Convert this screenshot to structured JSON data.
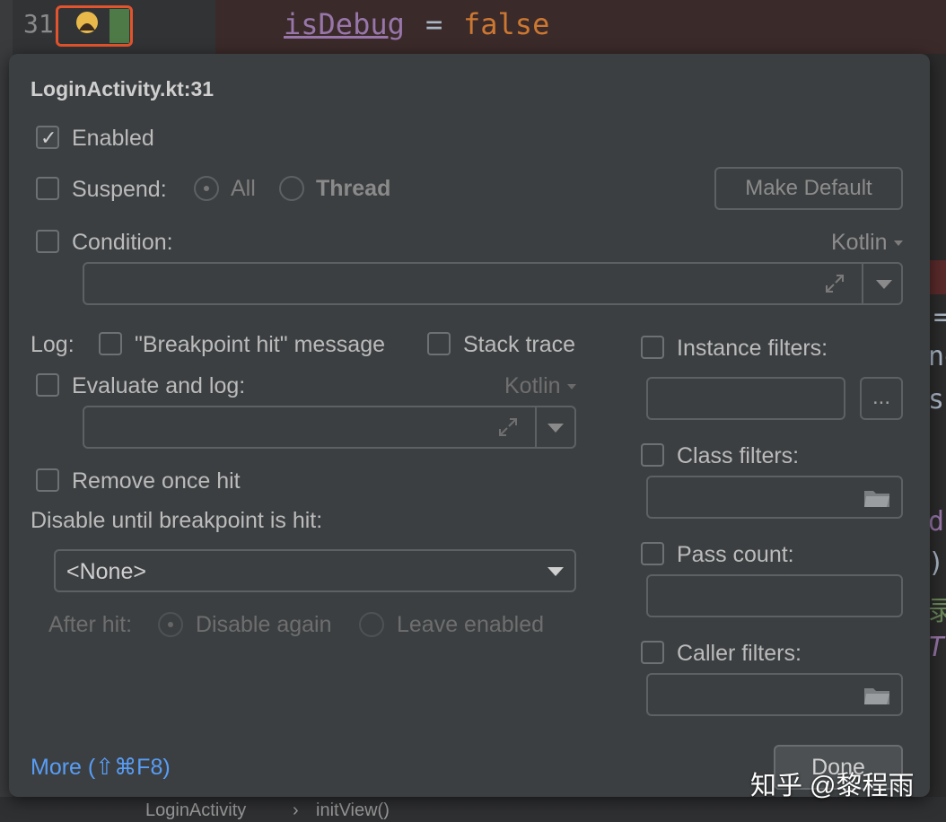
{
  "editor": {
    "line_number": "31",
    "code_variable": "isDebug",
    "code_operator": "=",
    "code_value": "false",
    "right_fragments": [
      "=",
      "ne",
      "s",
      "d",
      ")",
      "录",
      "T"
    ],
    "breadcrumb": [
      "LoginActivity",
      "›",
      "initView()"
    ]
  },
  "dialog": {
    "title": "LoginActivity.kt:31",
    "enabled": {
      "label": "Enabled",
      "checked": true
    },
    "suspend": {
      "label": "Suspend:",
      "checked": false,
      "options": [
        "All",
        "Thread"
      ],
      "selected": "All"
    },
    "make_default_label": "Make Default",
    "condition": {
      "label": "Condition:",
      "checked": false,
      "language": "Kotlin",
      "value": ""
    },
    "log": {
      "label": "Log:",
      "breakpoint_hit_label": "\"Breakpoint hit\" message",
      "stack_trace_label": "Stack trace"
    },
    "evaluate": {
      "label": "Evaluate and log:",
      "checked": false,
      "language": "Kotlin",
      "value": ""
    },
    "remove_once_hit": {
      "label": "Remove once hit",
      "checked": false
    },
    "disable_until": {
      "label": "Disable until breakpoint is hit:",
      "selected": "<None>"
    },
    "after_hit": {
      "label": "After hit:",
      "options": [
        "Disable again",
        "Leave enabled"
      ],
      "selected": "Disable again"
    },
    "instance_filters": {
      "label": "Instance filters:",
      "checked": false,
      "browse_label": "..."
    },
    "class_filters": {
      "label": "Class filters:",
      "checked": false
    },
    "pass_count": {
      "label": "Pass count:",
      "checked": false
    },
    "caller_filters": {
      "label": "Caller filters:",
      "checked": false
    },
    "more_link": "More (⇧⌘F8)",
    "done_label": "Done"
  },
  "watermark": "知乎 @黎程雨",
  "icons": {
    "breakpoint": "breakpoint-icon",
    "expand": "expand-icon",
    "folder": "folder-icon",
    "dropdown": "chevron-down-icon"
  },
  "colors": {
    "accent_link": "#589df6",
    "breakpoint_highlight": "#e2542d",
    "keyword": "#cc7832",
    "variable": "#9876aa"
  }
}
